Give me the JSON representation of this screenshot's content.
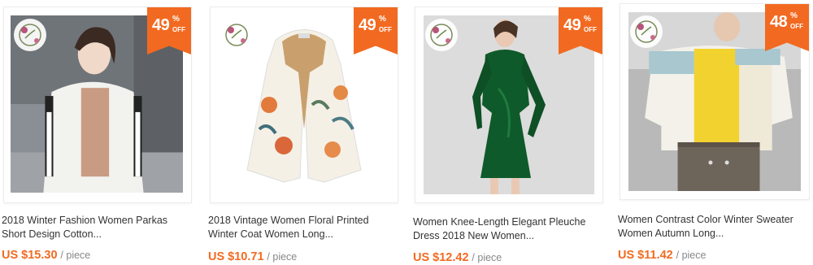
{
  "products": [
    {
      "discount_num": "49",
      "discount_pct": "%",
      "discount_off": "OFF",
      "title_line1": "2018 Winter Fashion Women Parkas",
      "title_line2": "Short Design Cotton...",
      "price": "US $15.30",
      "unit": "/ piece"
    },
    {
      "discount_num": "49",
      "discount_pct": "%",
      "discount_off": "OFF",
      "title_line1": "2018 Vintage Women Floral Printed",
      "title_line2": "Winter Coat Women Long...",
      "price": "US $10.71",
      "unit": "/ piece"
    },
    {
      "discount_num": "49",
      "discount_pct": "%",
      "discount_off": "OFF",
      "title_line1": "Women Knee-Length Elegant Pleuche",
      "title_line2": "Dress 2018 New Women...",
      "price": "US $12.42",
      "unit": "/ piece"
    },
    {
      "discount_num": "48",
      "discount_pct": "%",
      "discount_off": "OFF",
      "title_line1": "Women Contrast Color Winter Sweater",
      "title_line2": "Women Autumn Long...",
      "price": "US $11.42",
      "unit": "/ piece"
    }
  ],
  "colors": {
    "accent": "#f26a21",
    "title_text": "#333333",
    "unit_text": "#888888"
  },
  "icons": {
    "store_logo": "floral-wreath-logo-icon"
  }
}
